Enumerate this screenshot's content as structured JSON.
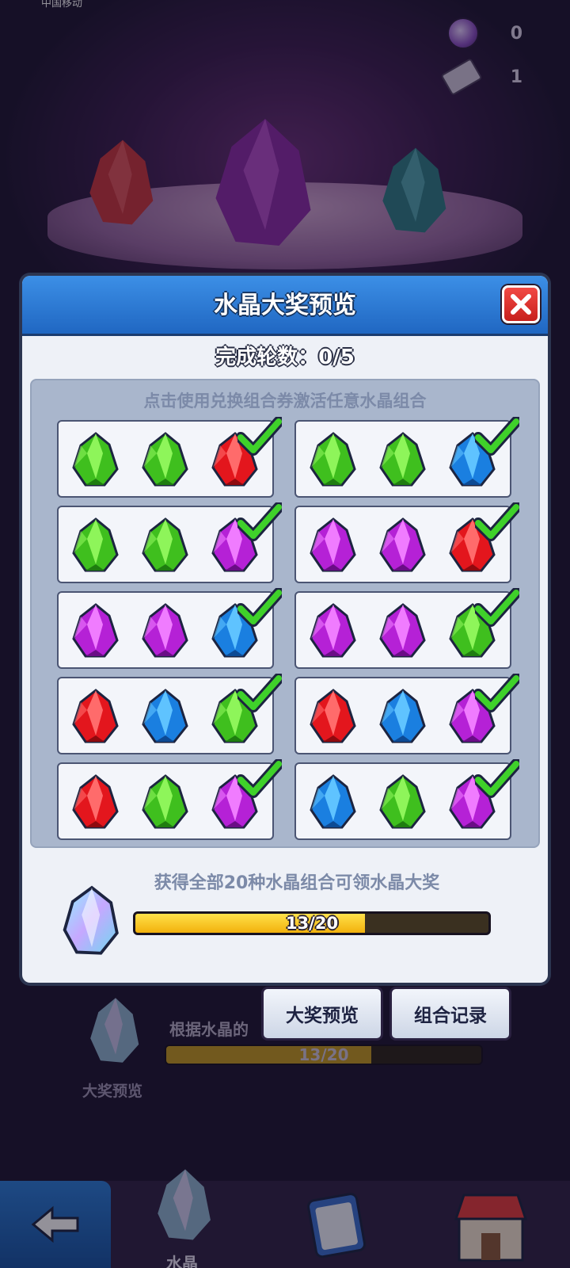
{
  "status_bar": {
    "carrier": "中国移动",
    "right": ""
  },
  "resources": [
    {
      "icon": "potion-icon",
      "value": "0"
    },
    {
      "icon": "ticket-icon",
      "value": "1"
    }
  ],
  "modal": {
    "title": "水晶大奖预览",
    "rounds_label": "完成轮数：0/5",
    "hint": "点击使用兑换组合券激活任意水晶组合",
    "combos": [
      {
        "gems": [
          "green",
          "green",
          "red"
        ],
        "checked": true
      },
      {
        "gems": [
          "green",
          "green",
          "blue"
        ],
        "checked": true
      },
      {
        "gems": [
          "green",
          "green",
          "purple"
        ],
        "checked": true
      },
      {
        "gems": [
          "purple",
          "purple",
          "red"
        ],
        "checked": true
      },
      {
        "gems": [
          "purple",
          "purple",
          "blue"
        ],
        "checked": true
      },
      {
        "gems": [
          "purple",
          "purple",
          "green"
        ],
        "checked": true
      },
      {
        "gems": [
          "red",
          "blue",
          "green"
        ],
        "checked": true
      },
      {
        "gems": [
          "red",
          "blue",
          "purple"
        ],
        "checked": true
      },
      {
        "gems": [
          "red",
          "green",
          "purple"
        ],
        "checked": true
      },
      {
        "gems": [
          "blue",
          "green",
          "purple"
        ],
        "checked": true
      }
    ],
    "footer_text": "获得全部20种水晶组合可领水晶大奖",
    "progress": {
      "current": 13,
      "total": 20,
      "label": "13/20"
    }
  },
  "background": {
    "progress_label": "根据水晶的",
    "progress_text": "13/20",
    "prize_label": "大奖预览",
    "tab_prize": "大奖预览",
    "tab_records": "组合记录",
    "nav_label": "水晶"
  },
  "colors": {
    "green": [
      "#8ef55a",
      "#3fbf1e",
      "#1f7d10"
    ],
    "red": [
      "#ff6b6b",
      "#e3161d",
      "#8f0a0f"
    ],
    "blue": [
      "#5fc3ff",
      "#1a7fe0",
      "#0d4a94"
    ],
    "purple": [
      "#f07cff",
      "#b521d6",
      "#6a0d86"
    ],
    "check": "#3fd12a",
    "header_blue": "#2a78d6",
    "progress_fill": "#f7c51c"
  }
}
